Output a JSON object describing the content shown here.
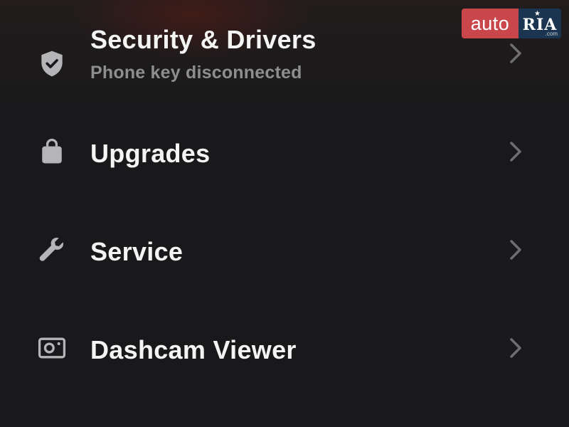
{
  "menu": {
    "items": [
      {
        "id": "security",
        "icon": "shield-check-icon",
        "label": "Security & Drivers",
        "sublabel": "Phone key disconnected"
      },
      {
        "id": "upgrades",
        "icon": "shopping-bag-icon",
        "label": "Upgrades"
      },
      {
        "id": "service",
        "icon": "wrench-icon",
        "label": "Service"
      },
      {
        "id": "dashcam",
        "icon": "dashcam-icon",
        "label": "Dashcam Viewer"
      }
    ]
  },
  "watermark": {
    "brand_left": "auto",
    "brand_right": "RIA",
    "suffix": ".com"
  },
  "colors": {
    "background": "#19191b",
    "text_primary": "#f4f4f4",
    "text_secondary": "#8e8e90",
    "icon": "#b5b5b7",
    "chevron": "#6e6e70",
    "watermark_red": "#c9464a",
    "watermark_navy": "#1b3550"
  }
}
